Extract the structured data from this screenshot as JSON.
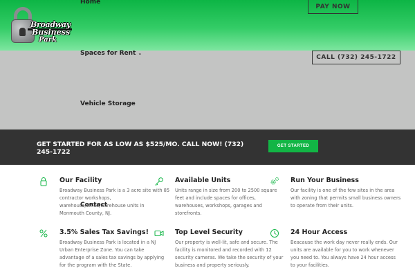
{
  "nav": {
    "home": "Home",
    "spaces": "Spaces for Rent",
    "vehicle": "Vehicle Storage",
    "contact": "Contact"
  },
  "logo": {
    "line1": "Broadway",
    "line2": "Business",
    "line3": "Park"
  },
  "buttons": {
    "pay": "PAY NOW",
    "call": "CALL (732) 245-1722",
    "get_started": "GET STARTED"
  },
  "cta": {
    "text": "GET STARTED FOR AS LOW AS $525/MO. CALL NOW! (732) 245-1722"
  },
  "colors": {
    "brand_green": "#0db545",
    "cta_band": "#333333",
    "header_gray": "#c3c4c3"
  },
  "features": [
    {
      "icon": "lock-icon",
      "title": "Our Facility",
      "text": "Broadway Business Park is a 3 acre site with 85 contractor workshops, warehouse/office/warehouse units in Monmouth County, NJ."
    },
    {
      "icon": "key-icon",
      "title": "Available Units",
      "text": "Units range in size from 200 to 2500 square feet and include spaces for offices, warehouses, workshops, garages and storefronts."
    },
    {
      "icon": "gears-icon",
      "title": "Run Your Business",
      "text": "Our facility is one of the few sites in the area with zoning that permits small business owners to operate from their units."
    },
    {
      "icon": "percent-icon",
      "title": "3.5% Sales Tax Savings!",
      "text": "Broadway Business Park is located in a NJ Urban Enterprise Zone. You can take advantage of a sales tax savings by applying for the program with the State."
    },
    {
      "icon": "video-camera-icon",
      "title": "Top Level Security",
      "text": "Our property is well-lit, safe and secure. The facility is monitored and recorded with 12 security cameras. We take the security of your business and property seriously."
    },
    {
      "icon": "clock-icon",
      "title": "24 Hour Access",
      "text": "Beacause the work day never really ends. Our units are available for you to work whenever you need to. You always have 24 hour access to your facilities."
    }
  ]
}
